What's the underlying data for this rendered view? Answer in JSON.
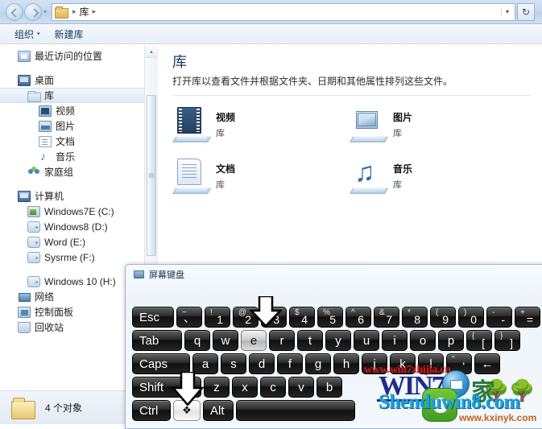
{
  "window": {
    "type": "windows-explorer"
  },
  "addressbar": {
    "back_icon": "back-arrow-icon",
    "forward_icon": "forward-arrow-icon",
    "history_caret": "▾",
    "folder_icon": "library-folder-icon",
    "separator": "▸",
    "crumb": "库",
    "dropdown_caret": "▾",
    "refresh_icon": "↻"
  },
  "toolbar": {
    "organize_label": "组织",
    "organize_caret": "▾",
    "new_library_label": "新建库"
  },
  "sidebar": {
    "items": [
      {
        "label": "最近访问的位置",
        "icon": "recent-places-icon",
        "indent": 0,
        "selected": false
      },
      {
        "label": "",
        "icon": "spacer",
        "indent": 0,
        "selected": false,
        "gap": true
      },
      {
        "label": "桌面",
        "icon": "desktop-icon",
        "indent": 0,
        "selected": false
      },
      {
        "label": "库",
        "icon": "library-icon",
        "indent": 1,
        "selected": true
      },
      {
        "label": "视频",
        "icon": "video-library-icon",
        "indent": 2,
        "selected": false
      },
      {
        "label": "图片",
        "icon": "pictures-library-icon",
        "indent": 2,
        "selected": false
      },
      {
        "label": "文档",
        "icon": "documents-library-icon",
        "indent": 2,
        "selected": false
      },
      {
        "label": "音乐",
        "icon": "music-library-icon",
        "indent": 2,
        "selected": false
      },
      {
        "label": "家庭组",
        "icon": "homegroup-icon",
        "indent": 1,
        "selected": false
      },
      {
        "label": "",
        "icon": "spacer",
        "indent": 0,
        "selected": false,
        "gap": true
      },
      {
        "label": "计算机",
        "icon": "computer-icon",
        "indent": 0,
        "selected": false
      },
      {
        "label": "Windows7E (C:)",
        "icon": "system-drive-icon",
        "indent": 1,
        "selected": false
      },
      {
        "label": "Windows8 (D:)",
        "icon": "drive-icon",
        "indent": 1,
        "selected": false
      },
      {
        "label": "Word (E:)",
        "icon": "drive-icon",
        "indent": 1,
        "selected": false
      },
      {
        "label": "Sysrme (F:)",
        "icon": "drive-icon",
        "indent": 1,
        "selected": false
      },
      {
        "label": "",
        "icon": "spacer",
        "indent": 0,
        "selected": false,
        "gap": true
      },
      {
        "label": "Windows 10 (H:)",
        "icon": "drive-icon",
        "indent": 1,
        "selected": false
      },
      {
        "label": "网络",
        "icon": "network-icon",
        "indent": 0,
        "selected": false
      },
      {
        "label": "控制面板",
        "icon": "control-panel-icon",
        "indent": 0,
        "selected": false
      },
      {
        "label": "回收站",
        "icon": "recycle-bin-icon",
        "indent": 0,
        "selected": false
      }
    ],
    "scroll_up_caret": "▴"
  },
  "content": {
    "title": "库",
    "subtitle": "打开库以查看文件并根据文件夹、日期和其他属性排列这些文件。",
    "libraries": [
      {
        "name": "视频",
        "kind": "库",
        "icon": "video-library-icon"
      },
      {
        "name": "图片",
        "kind": "库",
        "icon": "pictures-library-icon"
      },
      {
        "name": "文档",
        "kind": "库",
        "icon": "documents-library-icon"
      },
      {
        "name": "音乐",
        "kind": "库",
        "icon": "music-library-icon"
      }
    ]
  },
  "statusbar": {
    "icon": "folder-icon",
    "text": "4 个对象"
  },
  "osk": {
    "title": "屏幕键盘",
    "title_icon": "keyboard-icon",
    "rows": [
      {
        "name": "number-row",
        "keys": [
          {
            "label": "Esc",
            "width": "w-esc",
            "style": "label-left"
          },
          {
            "upper": "~",
            "lower": "、",
            "width": "w-u"
          },
          {
            "upper": "!",
            "lower": "1",
            "width": "w-u"
          },
          {
            "upper": "@",
            "lower": "2",
            "width": "w-u"
          },
          {
            "upper": "#",
            "lower": "3",
            "width": "w-u"
          },
          {
            "upper": "$",
            "lower": "4",
            "width": "w-u"
          },
          {
            "upper": "%",
            "lower": "5",
            "width": "w-u"
          },
          {
            "upper": "^",
            "lower": "6",
            "width": "w-u"
          },
          {
            "upper": "&",
            "lower": "7",
            "width": "w-u"
          },
          {
            "upper": "*",
            "lower": "8",
            "width": "w-u"
          },
          {
            "upper": "(",
            "lower": "9",
            "width": "w-u"
          },
          {
            "upper": ")",
            "lower": "0",
            "width": "w-u"
          },
          {
            "upper": "-",
            "lower": "-",
            "width": "w-u"
          },
          {
            "upper": "+",
            "lower": "=",
            "width": "w-u"
          }
        ]
      },
      {
        "name": "qwerty-row",
        "keys": [
          {
            "label": "Tab",
            "width": "w-tab",
            "style": "label-left"
          },
          {
            "label": "q",
            "width": "w-u"
          },
          {
            "label": "w",
            "width": "w-u"
          },
          {
            "label": "e",
            "width": "w-u",
            "pressed": true
          },
          {
            "label": "r",
            "width": "w-u"
          },
          {
            "label": "t",
            "width": "w-u"
          },
          {
            "label": "y",
            "width": "w-u"
          },
          {
            "label": "u",
            "width": "w-u"
          },
          {
            "label": "i",
            "width": "w-u"
          },
          {
            "label": "o",
            "width": "w-u"
          },
          {
            "label": "p",
            "width": "w-u"
          },
          {
            "upper": "{",
            "lower": "[",
            "width": "w-u"
          },
          {
            "upper": "}",
            "lower": "]",
            "width": "w-u"
          }
        ]
      },
      {
        "name": "home-row",
        "keys": [
          {
            "label": "Caps",
            "width": "w-caps",
            "style": "label-left"
          },
          {
            "label": "a",
            "width": "w-u"
          },
          {
            "label": "s",
            "width": "w-u"
          },
          {
            "label": "d",
            "width": "w-u"
          },
          {
            "label": "f",
            "width": "w-u"
          },
          {
            "label": "g",
            "width": "w-u"
          },
          {
            "label": "h",
            "width": "w-u"
          },
          {
            "label": "j",
            "width": "w-u"
          },
          {
            "label": "k",
            "width": "w-u"
          },
          {
            "label": "l",
            "width": "w-u"
          },
          {
            "upper": "\"",
            "lower": "'",
            "width": "w-u"
          },
          {
            "label": "←",
            "width": "w-u"
          }
        ]
      },
      {
        "name": "shift-row",
        "keys": [
          {
            "label": "Shift",
            "width": "w-shift",
            "style": "label-left"
          },
          {
            "label": "z",
            "width": "w-u"
          },
          {
            "label": "x",
            "width": "w-u"
          },
          {
            "label": "c",
            "width": "w-u"
          },
          {
            "label": "v",
            "width": "w-u"
          },
          {
            "label": "b",
            "width": "w-u"
          }
        ]
      },
      {
        "name": "bottom-row",
        "keys": [
          {
            "label": "Ctrl",
            "width": "w-ctrl",
            "style": "label-left"
          },
          {
            "label": "❖",
            "width": "w-win",
            "winkey": true
          },
          {
            "label": "Alt",
            "width": "w-alt",
            "style": "label-left"
          },
          {
            "label": "",
            "width": "w-space"
          }
        ]
      }
    ]
  },
  "annotations": {
    "arrow_on_e_key": "down-arrow-pointer",
    "arrow_on_win_key": "down-arrow-pointer"
  },
  "watermarks": {
    "red_url": "www.win7zhijia.cn",
    "win7_text": "WIN7.",
    "jia_text": "家",
    "shenduwin8": "Shenduwin8.com",
    "kxinyk": "www.kxinyk.com"
  },
  "colors": {
    "accent": "#1b3d66",
    "selection": "#dfeaf5",
    "key_dark": "#1a1a1a",
    "watermark_red": "#e31414",
    "watermark_blue": "#1f2d8a",
    "watermark_cyan": "#1ba2e0"
  }
}
